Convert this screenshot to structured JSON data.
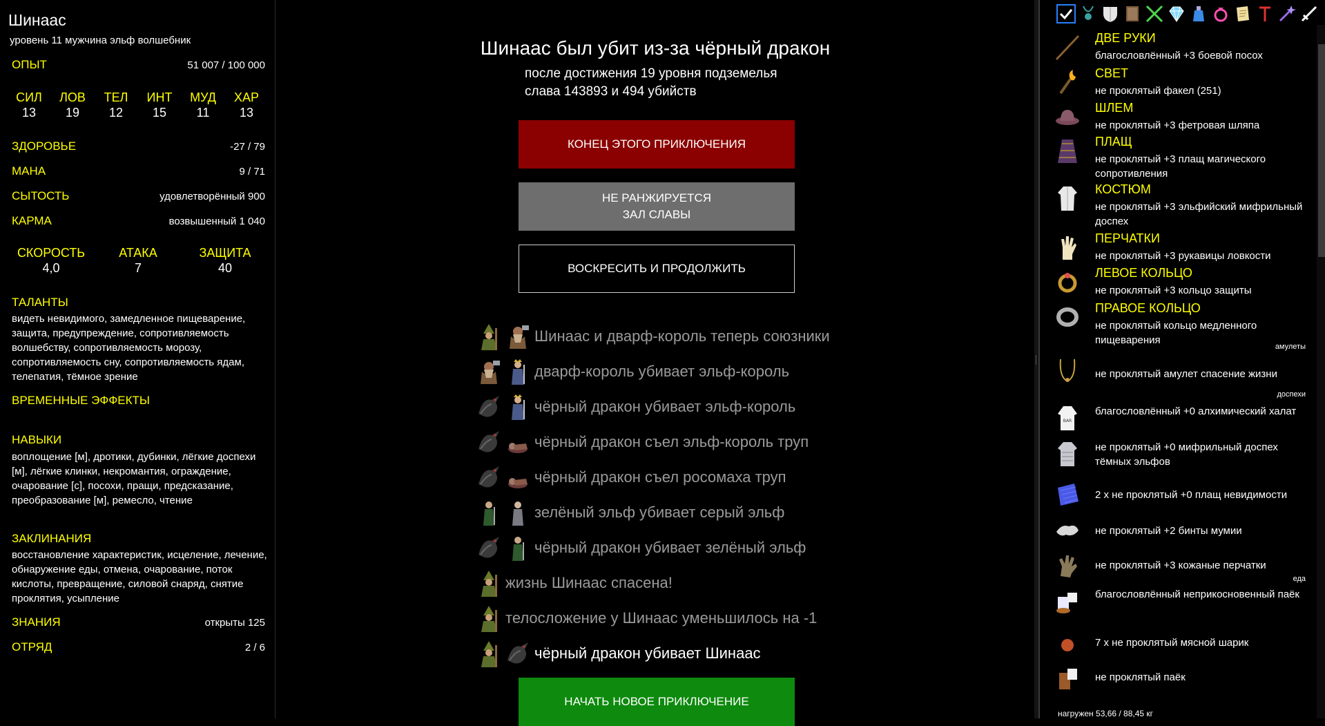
{
  "character": {
    "name": "Шинаас",
    "description": "уровень 11 мужчина эльф волшебник",
    "rows": [
      {
        "label": "ОПЫТ",
        "value": "51 007 / 100 000"
      },
      {
        "label": "ЗДОРОВЬЕ",
        "value": "-27 / 79"
      },
      {
        "label": "МАНА",
        "value": "9 / 71"
      },
      {
        "label": "СЫТОСТЬ",
        "value": "удовлетворённый 900"
      },
      {
        "label": "КАРМА",
        "value": "возвышенный 1 040"
      }
    ],
    "attributes": [
      {
        "label": "СИЛ",
        "value": "13"
      },
      {
        "label": "ЛОВ",
        "value": "19"
      },
      {
        "label": "ТЕЛ",
        "value": "12"
      },
      {
        "label": "ИНТ",
        "value": "15"
      },
      {
        "label": "МУД",
        "value": "11"
      },
      {
        "label": "ХАР",
        "value": "13"
      }
    ],
    "combat": [
      {
        "label": "СКОРОСТЬ",
        "value": "4,0"
      },
      {
        "label": "АТАКА",
        "value": "7"
      },
      {
        "label": "ЗАЩИТА",
        "value": "40"
      }
    ],
    "talents_label": "ТАЛАНТЫ",
    "talents": "видеть невидимого, замедленное пищеварение, защита, предупреждение, сопротивляемость волшебству, сопротивляемость морозу, сопротивляемость сну, сопротивляемость ядам, телепатия, тёмное зрение",
    "effects_label": "ВРЕМЕННЫЕ ЭФФЕКТЫ",
    "skills_label": "НАВЫКИ",
    "skills": "воплощение [м], дротики, дубинки, лёгкие доспехи [м], лёгкие клинки, некромантия, ограждение, очарование [с], посохи, пращи, предсказание, преобразование [м], ремесло, чтение",
    "spells_label": "ЗАКЛИНАНИЯ",
    "spells": "восстановление характеристик, исцеление, лечение, обнаружение еды, отмена, очарование, поток кислоты, превращение, силовой снаряд, снятие проклятия, усыпление",
    "knowledge": {
      "label": "ЗНАНИЯ",
      "value": "открыты 125"
    },
    "party": {
      "label": "ОТРЯД",
      "value": "2 / 6"
    }
  },
  "death": {
    "title": "Шинаас был убит из-за чёрный дракон",
    "line1": "после достижения 19 уровня подземелья",
    "line2": "слава 143893 и 494 убийств",
    "end_button": "КОНЕЦ ЭТОГО ПРИКЛЮЧЕНИЯ",
    "rank_button_1": "НЕ РАНЖИРУЕТСЯ",
    "rank_button_2": "ЗАЛ СЛАВЫ",
    "resurrect_button": "ВОСКРЕСИТЬ И ПРОДОЛЖИТЬ",
    "new_button": "НАЧАТЬ НОВОЕ ПРИКЛЮЧЕНИЕ",
    "colors": {
      "end": "#8b0000",
      "rank": "#6e6e6e",
      "new": "#0e8a0e"
    }
  },
  "log": [
    {
      "text": "Шинаас и дварф-король теперь союзники",
      "icons": [
        "wizard-icon",
        "dwarf-icon"
      ]
    },
    {
      "text": "дварф-король убивает эльф-король",
      "icons": [
        "dwarf-icon",
        "elf-king-icon"
      ]
    },
    {
      "text": "чёрный дракон убивает эльф-король",
      "icons": [
        "dragon-icon",
        "elf-king-icon"
      ]
    },
    {
      "text": "чёрный дракон съел эльф-король труп",
      "icons": [
        "dragon-icon",
        "corpse-icon"
      ]
    },
    {
      "text": "чёрный дракон съел росомаха труп",
      "icons": [
        "dragon-icon",
        "corpse-icon"
      ]
    },
    {
      "text": "зелёный эльф убивает серый эльф",
      "icons": [
        "green-elf-icon",
        "grey-elf-icon"
      ]
    },
    {
      "text": "чёрный дракон убивает зелёный эльф",
      "icons": [
        "dragon-icon",
        "green-elf-icon"
      ]
    },
    {
      "text": "жизнь Шинаас спасена!",
      "icons": [
        "wizard-icon"
      ]
    },
    {
      "text": "телосложение у Шинаас уменьшилось на -1",
      "icons": [
        "wizard-icon"
      ]
    },
    {
      "text": "чёрный дракон убивает Шинаас",
      "icons": [
        "wizard-icon",
        "dragon-icon"
      ]
    }
  ],
  "inventory": {
    "toolbar": [
      "checkmark-icon",
      "amulet-icon",
      "shield-icon",
      "book-icon",
      "weapon-icon",
      "gem-icon",
      "potion-icon",
      "ring-icon",
      "scroll-icon",
      "tool-icon",
      "wand-icon",
      "sword-icon"
    ],
    "equipped": [
      {
        "slot": "ДВЕ РУКИ",
        "desc": "благословлённый +3 боевой посох",
        "icon": "staff-icon"
      },
      {
        "slot": "СВЕТ",
        "desc": "не проклятый факел (251)",
        "icon": "torch-icon"
      },
      {
        "slot": "ШЛЕМ",
        "desc": "не проклятый +3 фетровая шляпа",
        "icon": "hat-icon"
      },
      {
        "slot": "ПЛАЩ",
        "desc": "не проклятый +3 плащ магического сопротивления",
        "icon": "cloak-icon"
      },
      {
        "slot": "КОСТЮМ",
        "desc": "не проклятый +3 эльфийский мифрильный доспех",
        "icon": "robe-icon"
      },
      {
        "slot": "ПЕРЧАТКИ",
        "desc": "не проклятый +3 рукавицы ловкости",
        "icon": "gloves-icon"
      },
      {
        "slot": "ЛЕВОЕ КОЛЬЦО",
        "desc": "не проклятый +3 кольцо защиты",
        "icon": "ring-icon"
      },
      {
        "slot": "ПРАВОЕ КОЛЬЦО",
        "desc": "не проклятый кольцо медленного пищеварения",
        "icon": "ring-silver-icon"
      }
    ],
    "group_amulets": "амулеты",
    "amulet": "не проклятый амулет спасение жизни",
    "group_armor": "доспехи",
    "armor": [
      "благословлённый +0 алхимический халат",
      "не проклятый +0 мифрильный доспех тёмных эльфов",
      "2 х не проклятый +0 плащ невидимости",
      "не проклятый +2 бинты мумии",
      "не проклятый +3 кожаные перчатки"
    ],
    "group_food": "еда",
    "food": [
      "благословлённый неприкосновенный паёк",
      "7 х не проклятый мясной шарик",
      "не проклятый паёк"
    ],
    "weight": "нагружен 53,66 / 88,45 кг"
  }
}
